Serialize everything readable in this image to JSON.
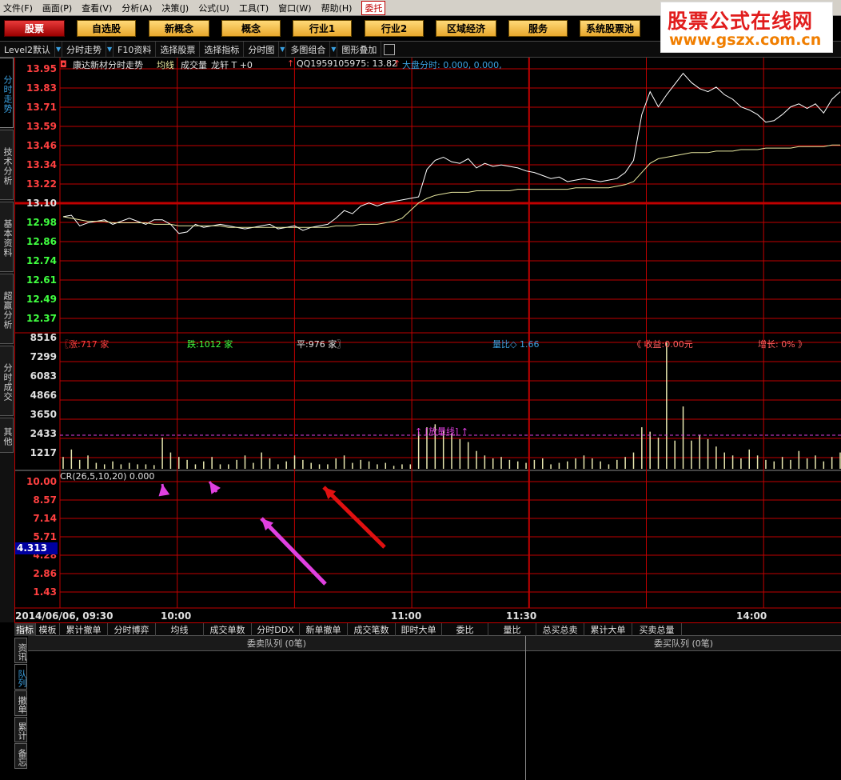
{
  "menubar": {
    "items": [
      "文件(F)",
      "画面(P)",
      "查看(V)",
      "分析(A)",
      "决策(J)",
      "公式(U)",
      "工具(T)",
      "窗口(W)",
      "帮助(H)"
    ],
    "active_item": "委托"
  },
  "watermark": {
    "line1": "股票公式在线网",
    "line2": "www.gszx.com.cn"
  },
  "buttonbar": [
    "股票",
    "自选股",
    "新概念",
    "概念",
    "行业1",
    "行业2",
    "区域经济",
    "服务",
    "系统股票池"
  ],
  "toolbar": {
    "level2": "Level2默认",
    "fenshi": "分时走势",
    "f10": "F10资料",
    "select_stock": "选择股票",
    "select_indicator": "选择指标",
    "fenshitu": "分时图",
    "multi": "多图组合",
    "overlay": "图形叠加"
  },
  "left_tabs": [
    "分时走势",
    "技术分析",
    "基本资料",
    "超赢分析",
    "分时成交",
    "其他"
  ],
  "price_header": {
    "title": "康达新材分时走势",
    "avg": "均线",
    "vol": "成交量",
    "longxuan": "龙轩 T +0",
    "qq": "QQ1959105975: 13.82",
    "market": "大盘分时: 0.000, 0.000,"
  },
  "price_axis": [
    "13.95",
    "13.83",
    "13.71",
    "13.59",
    "13.46",
    "13.34",
    "13.22",
    "13.10",
    "12.98",
    "12.86",
    "12.74",
    "12.61",
    "12.49",
    "12.37"
  ],
  "volume_axis": [
    "8516",
    "7299",
    "6083",
    "4866",
    "3650",
    "2433",
    "1217"
  ],
  "volume_header": {
    "up": "〖涨:717 家",
    "down": "跌:1012 家",
    "flat": "平:976 家〗",
    "ratio": "量比◇ 1.66",
    "income": "《 收益:0.00元",
    "growth": "增长: 0% 》",
    "fangliang": "↑ [放量线] ↑"
  },
  "cr_header": "CR(26,5,10,20) 0.000",
  "cr_axis": [
    "10.00",
    "8.57",
    "7.14",
    "5.71",
    "4.28",
    "2.86",
    "1.43"
  ],
  "cr_cursor": "4.313",
  "time_axis": {
    "date": "2014/06/06, 09:30",
    "ticks": [
      "10:00",
      "11:00",
      "11:30",
      "14:00"
    ]
  },
  "bottom_tabs": [
    "指标",
    "模板",
    "累计撤单",
    "分时博弈",
    "均线",
    "成交单数",
    "分时DDX",
    "新单撤单",
    "成交笔数",
    "即时大单",
    "委比",
    "量比",
    "总买总卖",
    "累计大单",
    "买卖总量"
  ],
  "queue": {
    "sell": "委卖队列 (0笔)",
    "buy": "委买队列 (0笔)",
    "side_tabs": [
      "资讯",
      "队列",
      "撤单",
      "累计",
      "备忘"
    ]
  },
  "colors": {
    "grid": "#c00000",
    "price_line": "#ffffff",
    "avg_line": "#e8e8a0",
    "volume_bar": "#e8e8b0",
    "up": "#ff4040",
    "down": "#40ff40",
    "arrow_red": "#e01010",
    "arrow_magenta": "#e040e0",
    "accent_blue": "#3aa0e0"
  },
  "chart_data": {
    "type": "line",
    "title": "康达新材分时走势",
    "ylim": [
      12.25,
      13.95
    ],
    "prev_close": 13.1,
    "price": [
      12.98,
      12.99,
      12.92,
      12.94,
      12.95,
      12.96,
      12.93,
      12.95,
      12.97,
      12.95,
      12.93,
      12.96,
      12.96,
      12.93,
      12.87,
      12.88,
      12.93,
      12.91,
      12.92,
      12.93,
      12.92,
      12.91,
      12.9,
      12.91,
      12.92,
      12.93,
      12.9,
      12.91,
      12.92,
      12.89,
      12.91,
      12.92,
      12.93,
      12.97,
      13.02,
      13.0,
      13.05,
      13.07,
      13.05,
      13.07,
      13.08,
      13.09,
      13.1,
      13.11,
      13.29,
      13.35,
      13.37,
      13.34,
      13.33,
      13.36,
      13.3,
      13.33,
      13.31,
      13.32,
      13.31,
      13.3,
      13.28,
      13.27,
      13.25,
      13.23,
      13.24,
      13.21,
      13.22,
      13.23,
      13.22,
      13.21,
      13.22,
      13.23,
      13.27,
      13.35,
      13.65,
      13.8,
      13.7,
      13.78,
      13.85,
      13.92,
      13.86,
      13.82,
      13.8,
      13.83,
      13.78,
      13.75,
      13.7,
      13.68,
      13.65,
      13.6,
      13.61,
      13.65,
      13.7,
      13.72,
      13.69,
      13.72,
      13.66,
      13.75,
      13.8
    ],
    "avg": [
      12.98,
      12.97,
      12.96,
      12.95,
      12.95,
      12.95,
      12.94,
      12.94,
      12.94,
      12.94,
      12.94,
      12.93,
      12.93,
      12.93,
      12.92,
      12.92,
      12.92,
      12.92,
      12.92,
      12.92,
      12.91,
      12.91,
      12.91,
      12.91,
      12.91,
      12.91,
      12.91,
      12.91,
      12.91,
      12.91,
      12.91,
      12.91,
      12.91,
      12.92,
      12.92,
      12.92,
      12.93,
      12.93,
      12.93,
      12.94,
      12.95,
      12.97,
      13.02,
      13.07,
      13.1,
      13.12,
      13.13,
      13.14,
      13.14,
      13.14,
      13.15,
      13.15,
      13.15,
      13.15,
      13.15,
      13.16,
      13.16,
      13.16,
      13.16,
      13.16,
      13.16,
      13.16,
      13.17,
      13.17,
      13.17,
      13.17,
      13.17,
      13.18,
      13.19,
      13.21,
      13.27,
      13.33,
      13.36,
      13.37,
      13.38,
      13.39,
      13.4,
      13.4,
      13.4,
      13.41,
      13.41,
      13.41,
      13.42,
      13.42,
      13.42,
      13.43,
      13.43,
      13.43,
      13.43,
      13.44,
      13.44,
      13.44,
      13.44,
      13.45,
      13.45
    ],
    "volume": [
      800,
      1300,
      600,
      900,
      400,
      300,
      500,
      300,
      400,
      300,
      300,
      250,
      2100,
      1100,
      800,
      600,
      300,
      500,
      800,
      300,
      300,
      600,
      900,
      400,
      1100,
      700,
      300,
      500,
      900,
      600,
      400,
      300,
      300,
      700,
      900,
      400,
      600,
      500,
      300,
      400,
      200,
      300,
      300,
      2500,
      2800,
      3000,
      2600,
      2400,
      2000,
      1800,
      1200,
      900,
      700,
      800,
      600,
      500,
      400,
      600,
      700,
      300,
      400,
      500,
      700,
      900,
      700,
      500,
      300,
      600,
      800,
      1100,
      2800,
      2500,
      2100,
      8516,
      1900,
      4200,
      1900,
      2300,
      2000,
      1500,
      1100,
      900,
      700,
      1300,
      900,
      600,
      500,
      800,
      600,
      1200,
      700,
      900,
      500,
      800,
      1100
    ],
    "cr_range": [
      0,
      10.0
    ],
    "x_ticks": [
      "09:30",
      "10:00",
      "11:00",
      "11:30",
      "14:00"
    ]
  }
}
